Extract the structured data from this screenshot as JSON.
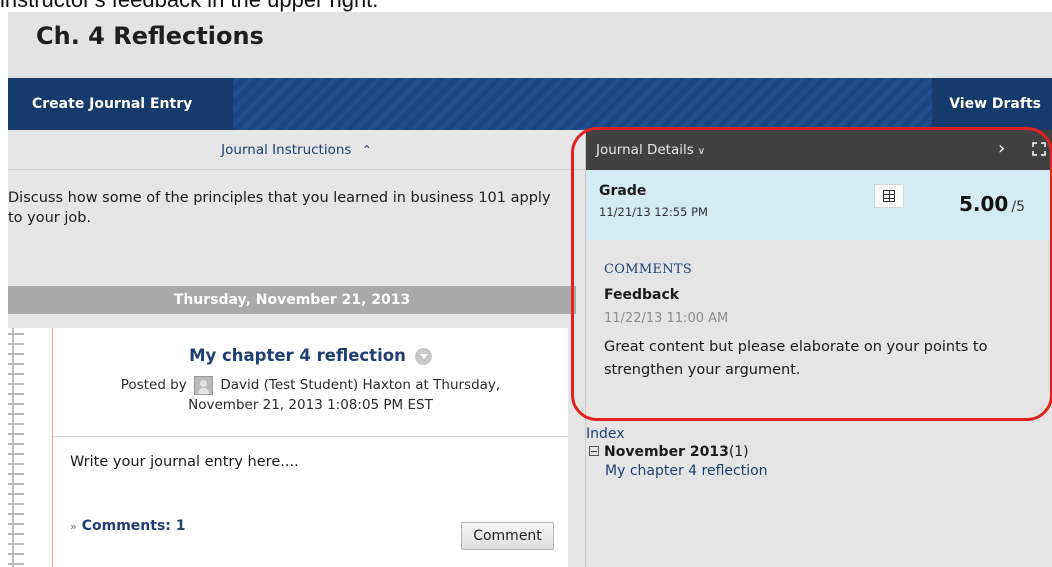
{
  "caption": "instructor's feedback in the upper right.",
  "page": {
    "title": "Ch. 4 Reflections"
  },
  "actions": {
    "create_label": "Create Journal Entry",
    "drafts_label": "View Drafts"
  },
  "instructions": {
    "header": "Journal Instructions",
    "text": "Discuss how some of the principles that you learned in business 101 apply to your job."
  },
  "entry_list": {
    "date_header": "Thursday, November 21, 2013",
    "entry": {
      "title": "My chapter 4 reflection",
      "posted_by_prefix": "Posted by",
      "author": "David (Test Student) Haxton",
      "posted_at_line1": "at Thursday,",
      "posted_at_line2": "November 21, 2013 1:08:05 PM EST",
      "body": "Write your journal entry here....",
      "comments_label": "Comments: 1",
      "comment_button": "Comment"
    }
  },
  "details": {
    "header": "Journal Details",
    "grade_label": "Grade",
    "grade_date": "11/21/13 12:55 PM",
    "grade_score": "5.00",
    "grade_max": "/5",
    "comments_heading": "COMMENTS",
    "feedback_label": "Feedback",
    "feedback_date": "11/22/13 11:00 AM",
    "feedback_text": "Great content but please elaborate on your points to strengthen your argument."
  },
  "index": {
    "heading": "Index",
    "month": "November 2013",
    "month_count": "(1)",
    "entries": [
      "My chapter 4 reflection"
    ]
  },
  "colors": {
    "accent": "#1f3f73",
    "action_bar": "#1f4f8f",
    "grade_band": "#d3ebf2",
    "highlight": "#e0231c"
  }
}
